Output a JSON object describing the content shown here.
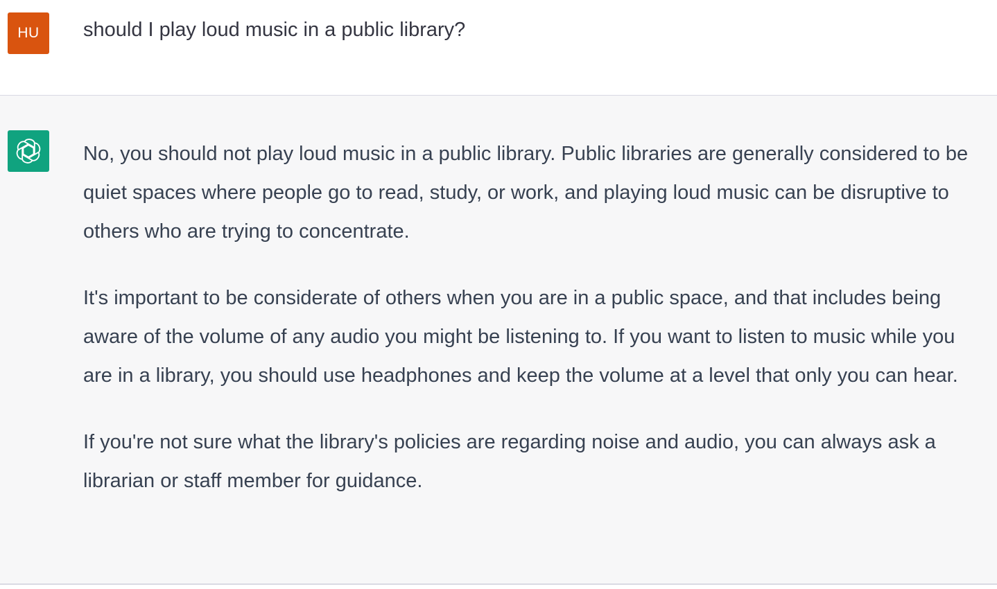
{
  "user_turn": {
    "avatar_initials": "HU",
    "avatar_color": "#d9540f",
    "message": "should I play loud music in a public library?"
  },
  "assistant_turn": {
    "avatar_icon": "openai-logo-icon",
    "avatar_color": "#10a37f",
    "paragraphs": [
      "No, you should not play loud music in a public library. Public libraries are generally considered to be quiet spaces where people go to read, study, or work, and playing loud music can be disruptive to others who are trying to concentrate.",
      "It's important to be considerate of others when you are in a public space, and that includes being aware of the volume of any audio you might be listening to. If you want to listen to music while you are in a library, you should use headphones and keep the volume at a level that only you can hear.",
      "If you're not sure what the library's policies are regarding noise and audio, you can always ask a librarian or staff member for guidance."
    ]
  }
}
